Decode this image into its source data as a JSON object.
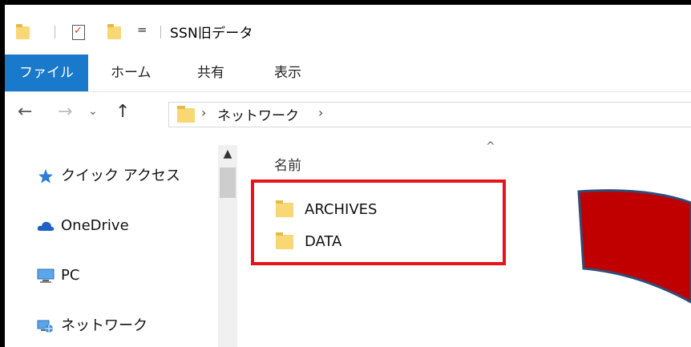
{
  "window": {
    "title": "SSN旧データ"
  },
  "quick_access": {
    "dropdown_glyph": "="
  },
  "ribbon": {
    "tabs": [
      "ファイル",
      "ホーム",
      "共有",
      "表示"
    ]
  },
  "address_bar": {
    "crumb": "ネットワーク"
  },
  "nav_pane": {
    "items": [
      {
        "label": "クイック アクセス",
        "icon": "star-pin-icon"
      },
      {
        "label": "OneDrive",
        "icon": "cloud-icon"
      },
      {
        "label": "PC",
        "icon": "computer-icon"
      },
      {
        "label": "ネットワーク",
        "icon": "network-icon"
      }
    ]
  },
  "file_list": {
    "column_name": "名前",
    "items": [
      {
        "name": "ARCHIVES",
        "type": "folder"
      },
      {
        "name": "DATA",
        "type": "folder"
      }
    ]
  },
  "colors": {
    "accent": "#1979ca",
    "highlight_border": "#e8121a",
    "annotation_arrow_fill": "#c00000",
    "annotation_arrow_stroke": "#2f4d7a"
  }
}
